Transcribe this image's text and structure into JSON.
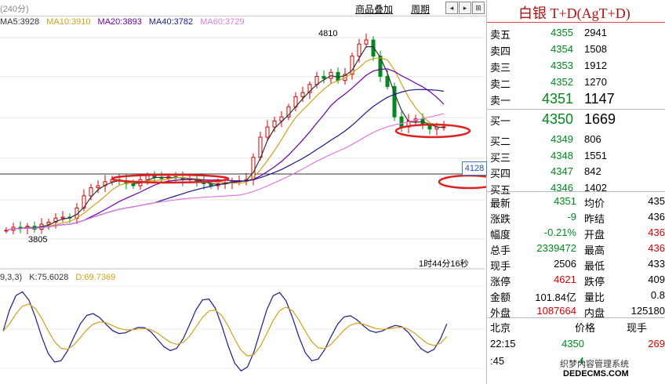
{
  "toolbar": {
    "period": "(240分)",
    "overlay_btn": "商品叠加",
    "cycle_btn": "周期"
  },
  "ma": {
    "ma5": "MA5:3928",
    "ma10": "MA10:3910",
    "ma20": "MA20:3893",
    "ma40": "MA40:3782",
    "ma60": "MA60:3729"
  },
  "kdj": {
    "params": "9,3,3)",
    "k": "K:75.6028",
    "d": "D:69.7369"
  },
  "chart_labels": {
    "high": "4810",
    "low": "3805",
    "marker": "4128",
    "countdown": "1时44分16秒"
  },
  "chart_data": {
    "type": "candlestick",
    "high_label": 4810,
    "low_label": 3805,
    "price_marker": 4128,
    "candles_close": [
      3840,
      3855,
      3850,
      3860,
      3845,
      3870,
      3880,
      3900,
      3905,
      3900,
      3950,
      4010,
      4050,
      4060,
      4080,
      4090,
      4085,
      4070,
      4060,
      4090,
      4110,
      4100,
      4095,
      4105,
      4100,
      4090,
      4095,
      4080,
      4070,
      4060,
      4070,
      4075,
      4080,
      4085,
      4090,
      4200,
      4300,
      4350,
      4380,
      4400,
      4450,
      4500,
      4520,
      4560,
      4600,
      4590,
      4620,
      4580,
      4610,
      4700,
      4760,
      4780,
      4700,
      4600,
      4550,
      4400,
      4350,
      4380,
      4390,
      4360,
      4340,
      4350,
      4351
    ]
  },
  "quote": {
    "name": "白银 T+D(AgT+D)",
    "asks": [
      {
        "label": "卖五",
        "price": "4355",
        "vol": "2941"
      },
      {
        "label": "卖四",
        "price": "4354",
        "vol": "1508"
      },
      {
        "label": "卖三",
        "price": "4353",
        "vol": "1912"
      },
      {
        "label": "卖二",
        "price": "4352",
        "vol": "1270"
      },
      {
        "label": "卖一",
        "price": "4351",
        "vol": "1147"
      }
    ],
    "bids": [
      {
        "label": "买一",
        "price": "4350",
        "vol": "1669"
      },
      {
        "label": "买二",
        "price": "4349",
        "vol": "806"
      },
      {
        "label": "买三",
        "price": "4348",
        "vol": "1551"
      },
      {
        "label": "买四",
        "price": "4347",
        "vol": "842"
      },
      {
        "label": "买五",
        "price": "4346",
        "vol": "1402"
      }
    ],
    "stats": [
      {
        "l1": "最新",
        "v1": "4351",
        "l2": "均价",
        "v2": "435"
      },
      {
        "l1": "涨跌",
        "v1": "-9",
        "l2": "昨结",
        "v2": "436"
      },
      {
        "l1": "幅度",
        "v1": "-0.21%",
        "l2": "开盘",
        "v2": "436"
      },
      {
        "l1": "总手",
        "v1": "2339472",
        "l2": "最高",
        "v2": "436"
      },
      {
        "l1": "现手",
        "v1": "2506",
        "l2": "最低",
        "v2": "433"
      },
      {
        "l1": "涨停",
        "v1": "4621",
        "l2": "跌停",
        "v2": "409"
      },
      {
        "l1": "金额",
        "v1": "101.84亿",
        "l2": "量比",
        "v2": "0.8"
      },
      {
        "l1": "外盘",
        "v1": "1087664",
        "l2": "内盘",
        "v2": "125180"
      }
    ],
    "ticks_header": {
      "city": "北京",
      "price": "价格",
      "vol": "现手"
    },
    "ticks": [
      {
        "time": "22:15",
        "price": "4350",
        "vol": "269"
      },
      {
        "time": ":45",
        "price": "4",
        "vol": ""
      }
    ]
  },
  "watermark": {
    "line1": "织梦内容管理系统",
    "line2": "DEDECMS.COM"
  },
  "colors": {
    "up": "#d40000",
    "down": "#00891e",
    "ma5": "#333333",
    "ma10": "#d4a017",
    "ma20": "#6b00a8",
    "ma40": "#1a1a8c",
    "ma60": "#e07ae0",
    "highlight_ellipse": "#e02020"
  }
}
